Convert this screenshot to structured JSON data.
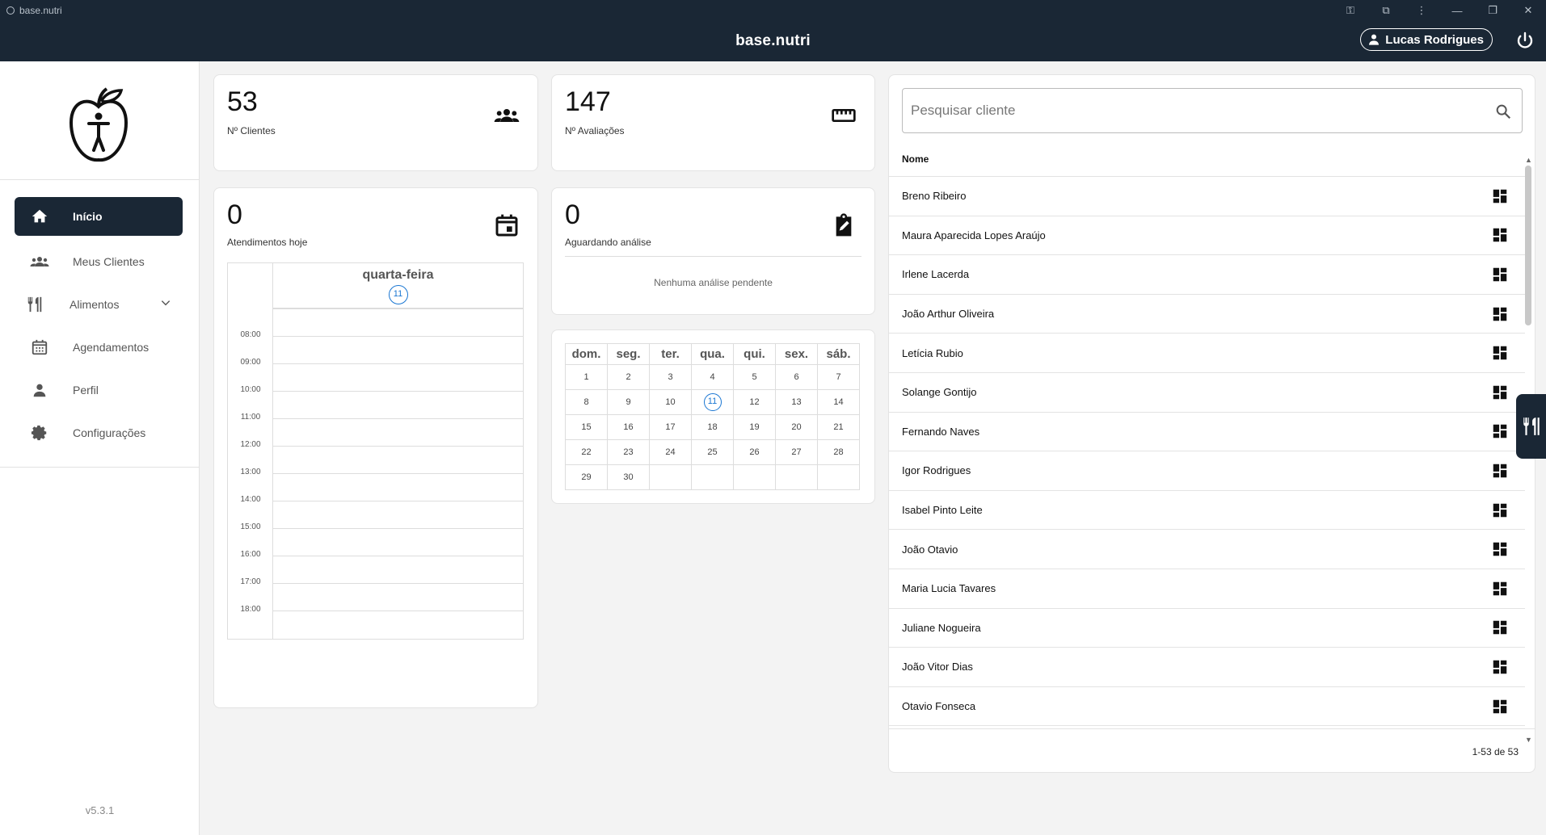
{
  "window": {
    "tab_title": "base.nutri",
    "app_title": "base.nutri"
  },
  "header": {
    "user_name": "Lucas Rodrigues"
  },
  "sidebar": {
    "items": [
      {
        "label": "Início",
        "icon": "home-icon"
      },
      {
        "label": "Meus Clientes",
        "icon": "groups-icon"
      },
      {
        "label": "Alimentos",
        "icon": "utensils-icon"
      },
      {
        "label": "Agendamentos",
        "icon": "calendar-icon"
      },
      {
        "label": "Perfil",
        "icon": "person-icon"
      },
      {
        "label": "Configurações",
        "icon": "gear-icon"
      }
    ],
    "version": "v5.3.1"
  },
  "stats": {
    "clients": {
      "value": "53",
      "label": "Nº Clientes"
    },
    "evaluations": {
      "value": "147",
      "label": "Nº Avaliações"
    },
    "today": {
      "value": "0",
      "label": "Atendimentos hoje"
    },
    "pending": {
      "value": "0",
      "label": "Aguardando análise",
      "empty": "Nenhuma análise pendente"
    }
  },
  "day_calendar": {
    "day_name": "quarta-feira",
    "day_number": "11",
    "hours": [
      "08:00",
      "09:00",
      "10:00",
      "11:00",
      "12:00",
      "13:00",
      "14:00",
      "15:00",
      "16:00",
      "17:00",
      "18:00"
    ]
  },
  "month_calendar": {
    "weekdays": [
      "dom.",
      "seg.",
      "ter.",
      "qua.",
      "qui.",
      "sex.",
      "sáb."
    ],
    "weeks": [
      [
        "1",
        "2",
        "3",
        "4",
        "5",
        "6",
        "7"
      ],
      [
        "8",
        "9",
        "10",
        "11",
        "12",
        "13",
        "14"
      ],
      [
        "15",
        "16",
        "17",
        "18",
        "19",
        "20",
        "21"
      ],
      [
        "22",
        "23",
        "24",
        "25",
        "26",
        "27",
        "28"
      ],
      [
        "29",
        "30",
        "",
        "",
        "",
        "",
        ""
      ]
    ],
    "today": "11"
  },
  "clients": {
    "search_placeholder": "Pesquisar cliente",
    "column_name": "Nome",
    "rows": [
      "Breno Ribeiro",
      "Maura Aparecida Lopes Araújo",
      "Irlene Lacerda",
      "João Arthur Oliveira",
      "Letícia Rubio",
      "Solange Gontijo",
      "Fernando Naves",
      "Igor Rodrigues",
      "Isabel Pinto Leite",
      "João Otavio",
      "Maria Lucia Tavares",
      "Juliane Nogueira",
      "João Vitor Dias",
      "Otavio Fonseca"
    ],
    "pagination": "1-53 de 53"
  },
  "colors": {
    "primary": "#1a2735",
    "today_accent": "#1976d2",
    "background": "#f3f3f3"
  }
}
